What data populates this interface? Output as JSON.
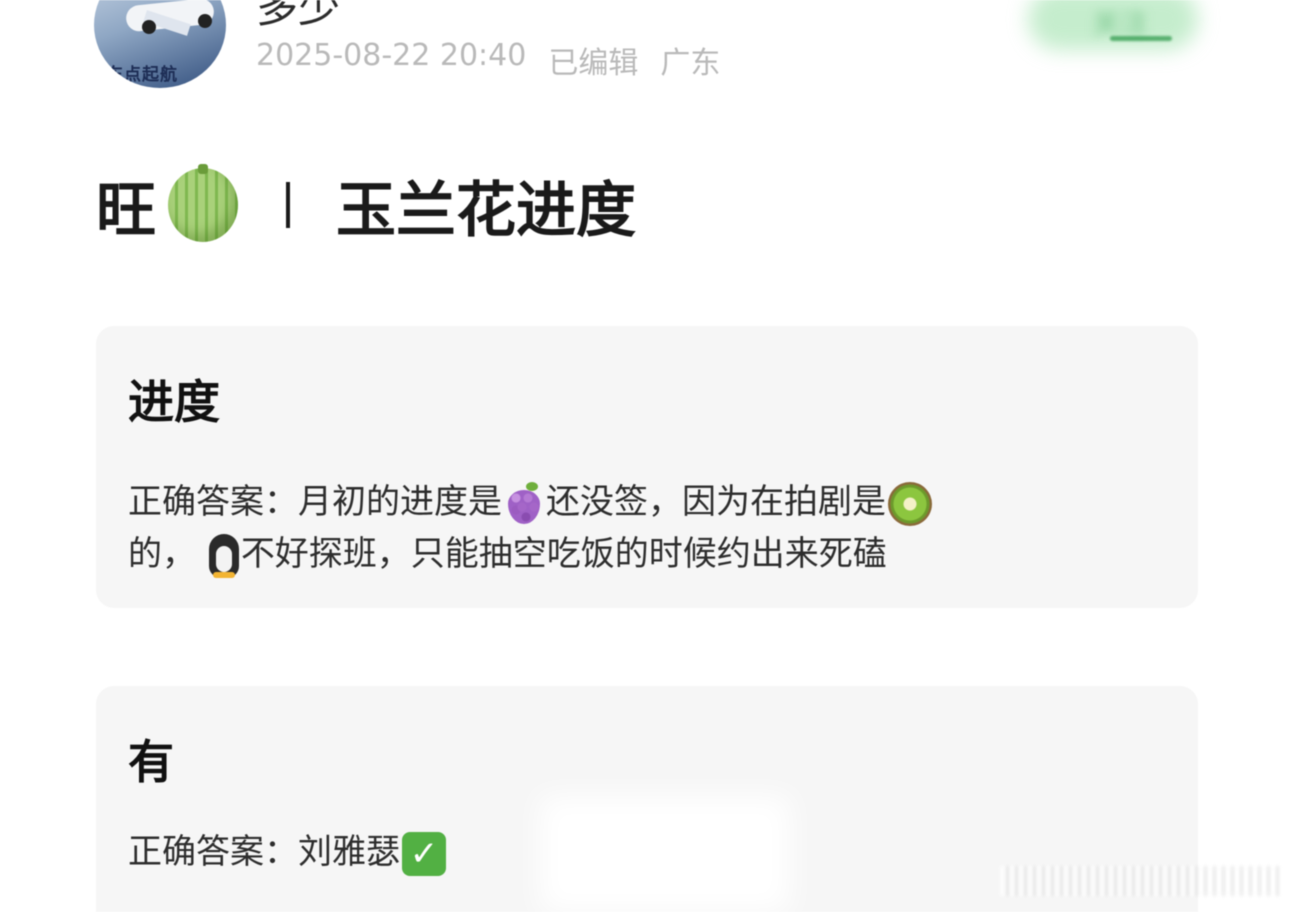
{
  "header": {
    "username": "多少",
    "timestamp": "2025-08-22 20:40",
    "edited": "已编辑",
    "location": "广东",
    "avatar_text": "东点起航",
    "follow_label": "关注"
  },
  "post": {
    "title_prefix": "旺",
    "title_main": "玉兰花进度"
  },
  "cards": [
    {
      "heading": "进度",
      "body_part1": "正确答案：月初的进度是",
      "body_part2": "还没签，因为在拍剧是",
      "body_part3": "的，",
      "body_part4": "不好探班，只能抽空吃饭的时候约出来死磕"
    },
    {
      "heading": "有",
      "body_part1": "正确答案：刘雅瑟"
    }
  ],
  "icons": {
    "melon": "melon-icon",
    "grapes": "grapes-icon",
    "kiwi": "kiwi-icon",
    "penguin": "penguin-icon",
    "check": "check-mark-icon"
  },
  "colors": {
    "card_background": "#f6f6f6",
    "meta_text": "#b9b9b9",
    "check_green": "#52b043"
  }
}
